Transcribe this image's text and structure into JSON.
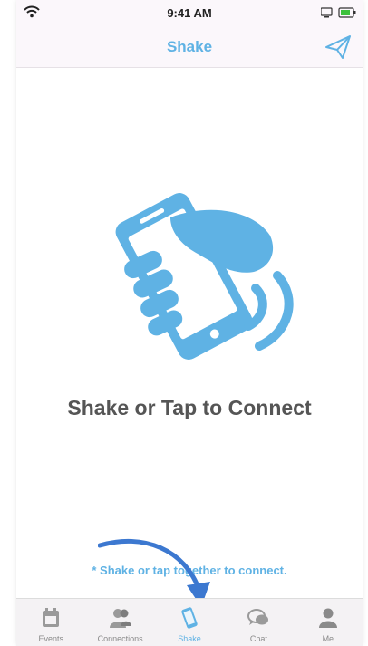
{
  "status": {
    "time": "9:41 AM"
  },
  "nav": {
    "title": "Shake"
  },
  "main": {
    "headline": "Shake or Tap to Connect",
    "hint": "* Shake or tap together to connect."
  },
  "tabs": [
    {
      "label": "Events",
      "icon": "calendar-icon",
      "active": false
    },
    {
      "label": "Connections",
      "icon": "people-icon",
      "active": false
    },
    {
      "label": "Shake",
      "icon": "phone-icon",
      "active": true
    },
    {
      "label": "Chat",
      "icon": "chat-bubbles-icon",
      "active": false
    },
    {
      "label": "Me",
      "icon": "person-icon",
      "active": false
    }
  ],
  "colors": {
    "accent": "#5fb2e4",
    "arrow": "#3c78d0",
    "headline": "#555555",
    "tab_inactive": "#8a8a8a"
  }
}
